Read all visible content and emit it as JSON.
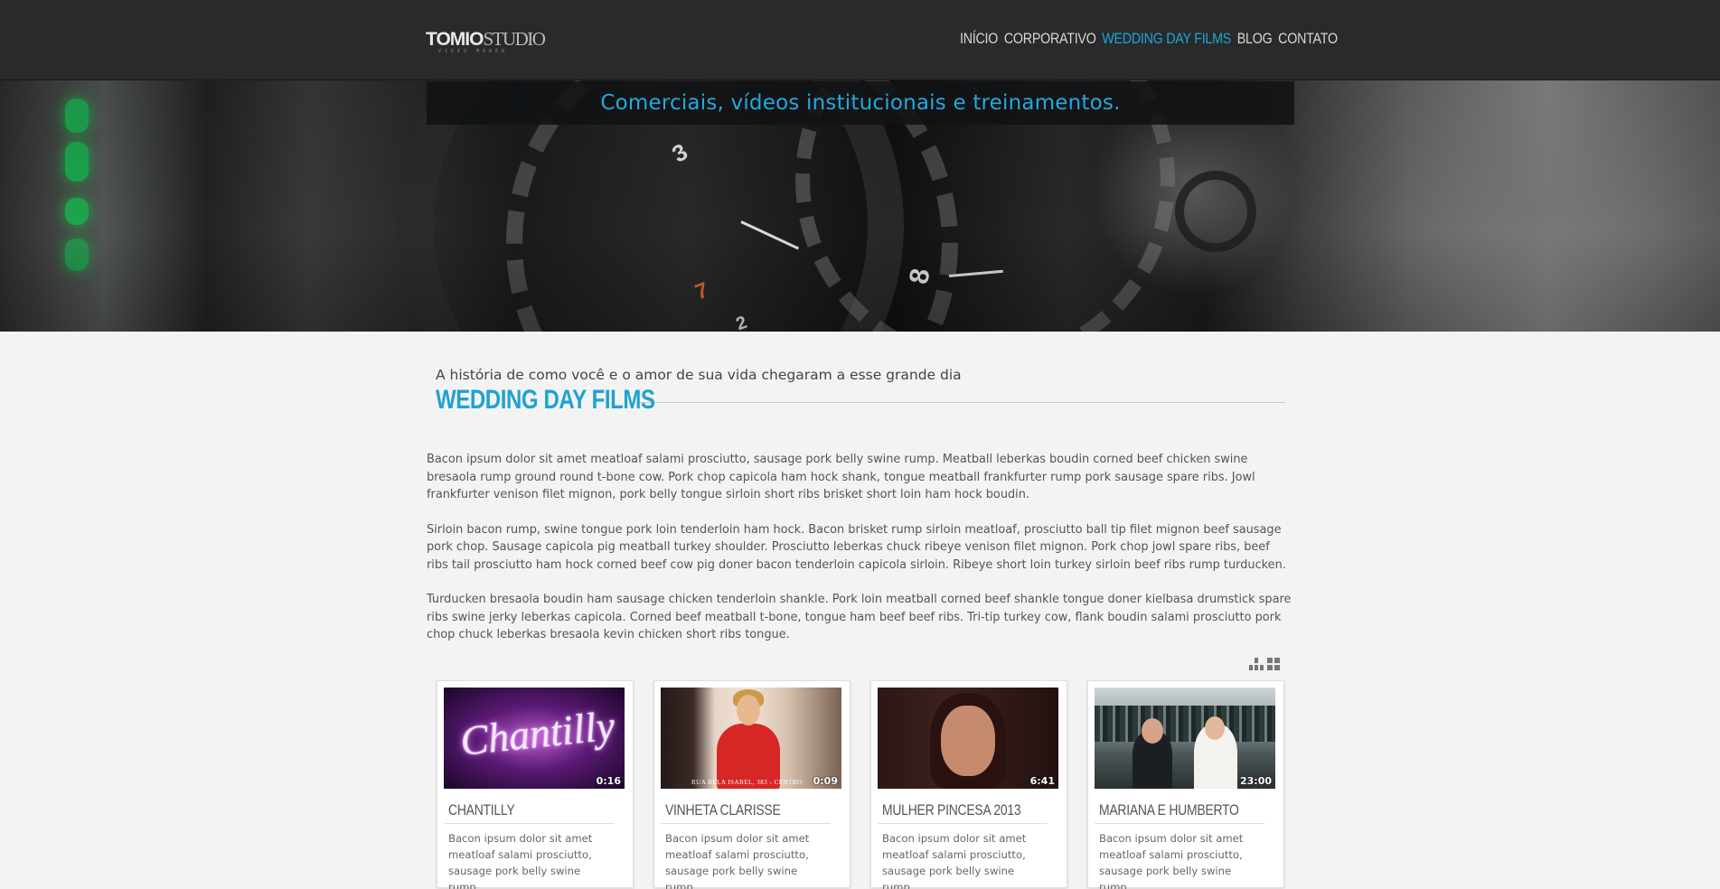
{
  "header": {
    "logo": {
      "bold": "TOMIO",
      "light": "STUDIO",
      "tagline": "VIDEO MAKER"
    },
    "nav": [
      {
        "label": "INÍCIO",
        "active": false
      },
      {
        "label": "CORPORATIVO",
        "active": false
      },
      {
        "label": "WEDDING DAY FILMS",
        "active": true
      },
      {
        "label": "BLOG",
        "active": false
      },
      {
        "label": "CONTATO",
        "active": false
      }
    ]
  },
  "hero": {
    "banner_text": "Comerciais, vídeos institucionais e treinamentos.",
    "lens_numbers": [
      "3",
      "7",
      "8",
      "2"
    ]
  },
  "section": {
    "subtitle": "A história de como você e o amor de sua vida chegaram a esse grande dia",
    "title": "WEDDING DAY FILMS"
  },
  "paragraphs": [
    "Bacon ipsum dolor sit amet meatloaf salami prosciutto, sausage pork belly swine rump. Meatball leberkas boudin corned beef chicken swine bresaola rump ground round t-bone cow. Pork chop capicola ham hock shank, tongue meatball frankfurter rump pork sausage spare ribs. Jowl frankfurter venison filet mignon, pork belly tongue sirloin short ribs brisket short loin ham hock boudin.",
    "Sirloin bacon rump, swine tongue pork loin tenderloin ham hock. Bacon brisket rump sirloin meatloaf, prosciutto ball tip filet mignon beef sausage pork chop. Sausage capicola pig meatball turkey shoulder. Prosciutto leberkas chuck ribeye venison filet mignon. Pork chop jowl spare ribs, beef ribs tail prosciutto ham hock corned beef cow pig doner bacon tenderloin capicola sirloin. Ribeye short loin turkey sirloin beef ribs rump turducken.",
    "Turducken bresaola boudin ham sausage chicken tenderloin shankle. Pork loin meatball corned beef shankle tongue doner kielbasa drumstick spare ribs swine jerky leberkas capicola. Corned beef meatball t-bone, tongue ham beef beef ribs. Tri-tip turkey cow, flank boudin salami prosciutto pork chop chuck leberkas bresaola kevin chicken short ribs tongue."
  ],
  "view_toggle": [
    "list-view-icon",
    "grid-view-icon"
  ],
  "videos": [
    {
      "title": "CHANTILLY",
      "duration": "0:16",
      "excerpt": "Bacon ipsum dolor sit amet meatloaf salami prosciutto, sausage pork belly swine rump....",
      "thumb_text": "Chantilly"
    },
    {
      "title": "VINHETA CLARISSE",
      "duration": "0:09",
      "excerpt": "Bacon ipsum dolor sit amet meatloaf salami prosciutto, sausage pork belly swine rump....",
      "thumb_text": "RUA BELA ISABEL, 383 - CENTRO"
    },
    {
      "title": "MULHER PINCESA 2013",
      "duration": "6:41",
      "excerpt": "Bacon ipsum dolor sit amet meatloaf salami prosciutto, sausage pork belly swine rump....",
      "thumb_text": ""
    },
    {
      "title": "MARIANA E HUMBERTO",
      "duration": "23:00",
      "excerpt": "Bacon ipsum dolor sit amet meatloaf salami prosciutto, sausage pork belly swine rump....",
      "thumb_text": ""
    }
  ],
  "colors": {
    "accent": "#1fa2d3",
    "topbar": "#2a2a2a",
    "page_bg": "#f3f3f3"
  }
}
